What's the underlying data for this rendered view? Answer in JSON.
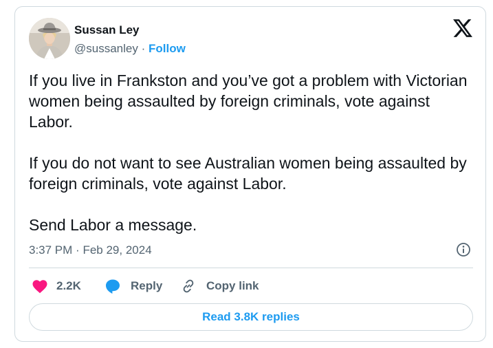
{
  "author": {
    "name": "Sussan Ley",
    "handle": "@sussanley",
    "separator": "·",
    "follow_label": "Follow"
  },
  "tweet": {
    "paragraphs": [
      "If you live in Frankston and you’ve got a problem with Victorian women being assaulted by foreign criminals, vote against Labor.",
      "If you do not want to see Australian women being assaulted by foreign criminals, vote against Labor.",
      "Send Labor a message."
    ],
    "time": "3:37 PM",
    "date": "Feb 29, 2024",
    "separator": "·"
  },
  "actions": {
    "like_count": "2.2K",
    "reply_label": "Reply",
    "copy_link_label": "Copy link"
  },
  "replies_button": {
    "label": "Read 3.8K replies"
  },
  "colors": {
    "accent": "#1d9bf0",
    "heart": "#f91880",
    "text": "#0f1419",
    "muted": "#536471",
    "border": "#cfd9de"
  },
  "icons": {
    "brand": "x-logo-icon",
    "like": "heart-icon",
    "reply": "speech-bubble-icon",
    "copy": "link-icon",
    "info": "info-icon"
  }
}
